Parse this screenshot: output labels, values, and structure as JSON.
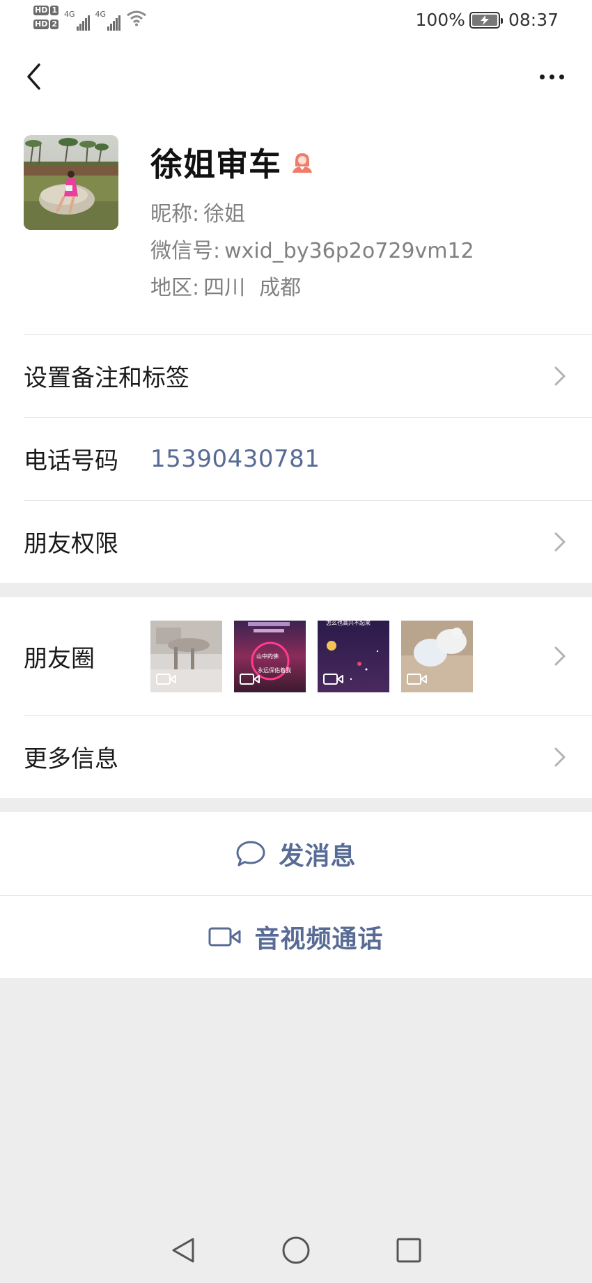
{
  "status_bar": {
    "hd1": "HD",
    "hd1_num": "1",
    "hd2": "HD",
    "hd2_num": "2",
    "signal1_label": "4G",
    "signal2_label": "4G",
    "battery_percent": "100%",
    "time": "08:37"
  },
  "nav": {
    "back_icon": "chevron-left-icon",
    "more_icon": "more-dots-icon"
  },
  "profile": {
    "name": "徐姐审车",
    "gender_icon": "female-person-icon",
    "nickname_label": "昵称:",
    "nickname": "徐姐",
    "wechat_id_label": "微信号:",
    "wechat_id": "wxid_by36p2o729vm12",
    "region_label": "地区:",
    "region_province": "四川",
    "region_city": "成都"
  },
  "cells": {
    "remark_tags": "设置备注和标签",
    "phone_label": "电话号码",
    "phone_value": "15390430781",
    "permissions": "朋友权限",
    "moments": "朋友圈",
    "more_info": "更多信息"
  },
  "moments_thumbs": {
    "thumb2_text1": "山中的佛",
    "thumb2_text2": "永远保佑着我",
    "thumb3_text": "怎么也高兴不起来"
  },
  "actions": {
    "send_message": "发消息",
    "video_call": "音视频通话"
  },
  "colors": {
    "link": "#576b95",
    "background": "#ededed",
    "gender_icon": "#f07c6b"
  }
}
